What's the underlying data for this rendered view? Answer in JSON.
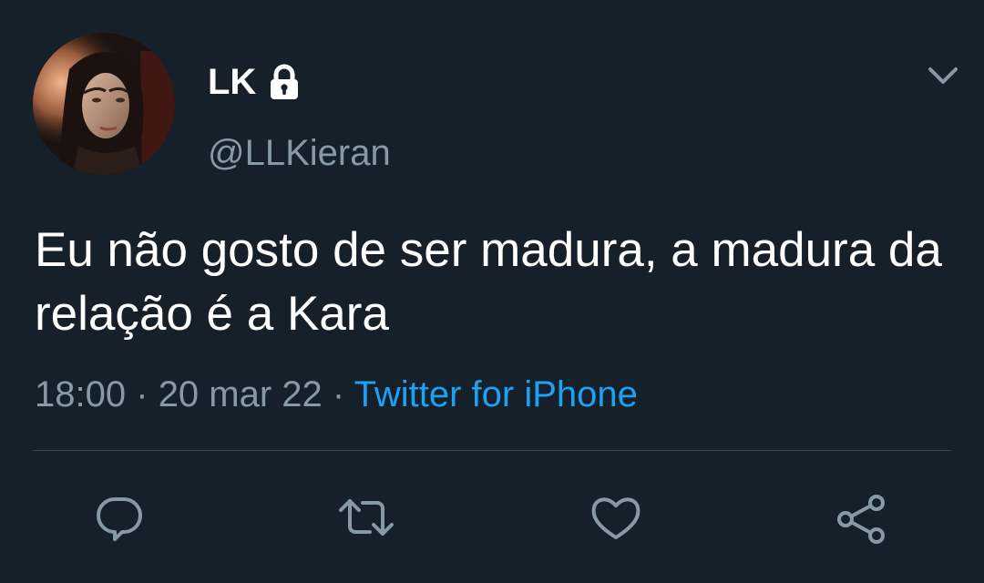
{
  "user": {
    "display_name": "LK",
    "handle": "@LLKieran",
    "protected": true
  },
  "tweet": {
    "text": "Eu não gosto de ser madura, a madura da relação é a Kara",
    "time": "18:00",
    "date": "20 mar 22",
    "source": "Twitter for iPhone",
    "separator": "·"
  },
  "actions": [
    "reply-icon",
    "retweet-icon",
    "like-icon",
    "share-icon"
  ],
  "colors": {
    "background": "#15202b",
    "primary_text": "#ffffff",
    "secondary_text": "#8899a6",
    "accent": "#1da1f2",
    "divider": "#38444d"
  }
}
